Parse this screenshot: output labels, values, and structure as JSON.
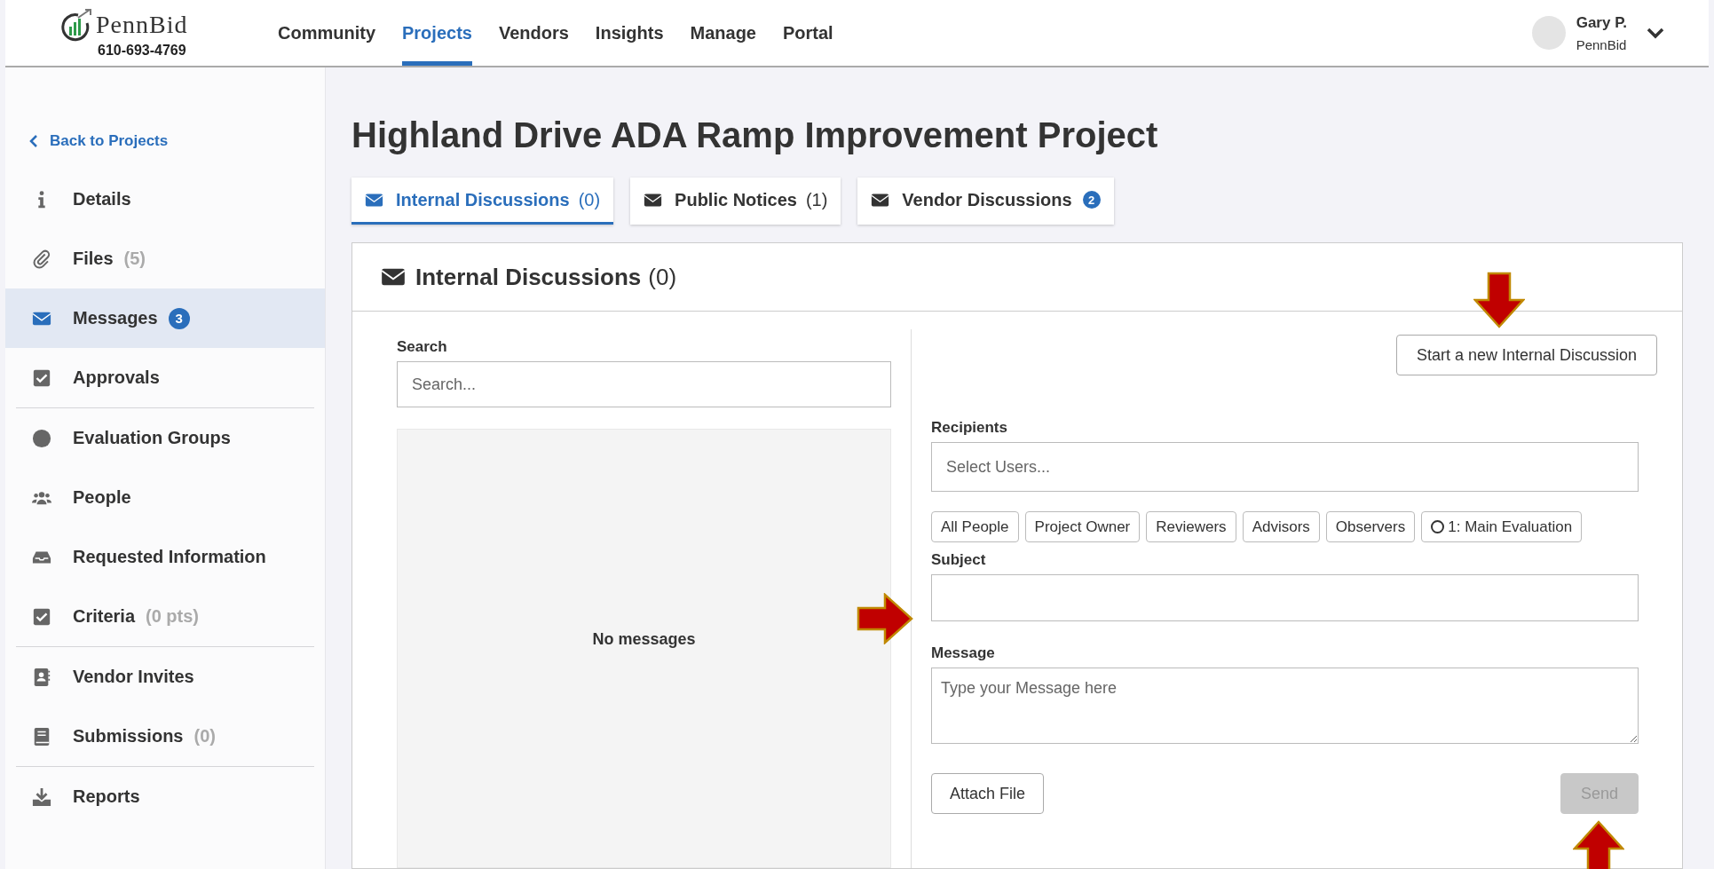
{
  "header": {
    "logo": {
      "name": "PennBid",
      "phone": "610-693-4769"
    },
    "nav": [
      {
        "label": "Community",
        "selected": false
      },
      {
        "label": "Projects",
        "selected": true
      },
      {
        "label": "Vendors",
        "selected": false
      },
      {
        "label": "Insights",
        "selected": false
      },
      {
        "label": "Manage",
        "selected": false
      },
      {
        "label": "Portal",
        "selected": false
      }
    ],
    "user": {
      "name": "Gary P.",
      "organization": "PennBid"
    }
  },
  "sidebar": {
    "back_link": "Back to Projects",
    "sections": [
      [
        {
          "label": "Details",
          "selected": false
        },
        {
          "label": "Files",
          "count": "(5)",
          "selected": false
        },
        {
          "label": "Messages",
          "badge": "3",
          "selected": true
        },
        {
          "label": "Approvals",
          "selected": false
        }
      ],
      [
        {
          "label": "Evaluation Groups",
          "selected": false
        },
        {
          "label": "People",
          "selected": false
        },
        {
          "label": "Requested Information",
          "selected": false
        },
        {
          "label": "Criteria",
          "count": "(0 pts)",
          "selected": false
        }
      ],
      [
        {
          "label": "Vendor Invites",
          "selected": false
        },
        {
          "label": "Submissions",
          "count": "(0)",
          "selected": false
        }
      ],
      [
        {
          "label": "Reports",
          "selected": false
        }
      ]
    ]
  },
  "page_title": "Highland Drive ADA Ramp Improvement Project",
  "tabs": [
    {
      "label": "Internal Discussions",
      "count": "(0)",
      "selected": true
    },
    {
      "label": "Public Notices",
      "count": "(1)",
      "selected": false
    },
    {
      "label": "Vendor Discussions",
      "badge": "2",
      "selected": false
    }
  ],
  "panel": {
    "title": "Internal Discussions",
    "count": "(0)",
    "search": {
      "label": "Search",
      "placeholder": "Search..."
    },
    "empty_message": "No messages",
    "new_button": "Start a new Internal Discussion",
    "recipients": {
      "label": "Recipients",
      "placeholder": "Select Users...",
      "groups": [
        {
          "label": "All People",
          "kind": "role"
        },
        {
          "label": "Project Owner",
          "kind": "role"
        },
        {
          "label": "Reviewers",
          "kind": "role"
        },
        {
          "label": "Advisors",
          "kind": "role"
        },
        {
          "label": "Observers",
          "kind": "role"
        },
        {
          "label": "1: Main Evaluation",
          "kind": "group"
        }
      ]
    },
    "subject": {
      "label": "Subject"
    },
    "message": {
      "label": "Message",
      "placeholder": "Type your Message here"
    },
    "attach_button": {
      "label": "Attach File",
      "disabled": false
    },
    "send_button": {
      "label": "Send",
      "disabled": true
    }
  }
}
